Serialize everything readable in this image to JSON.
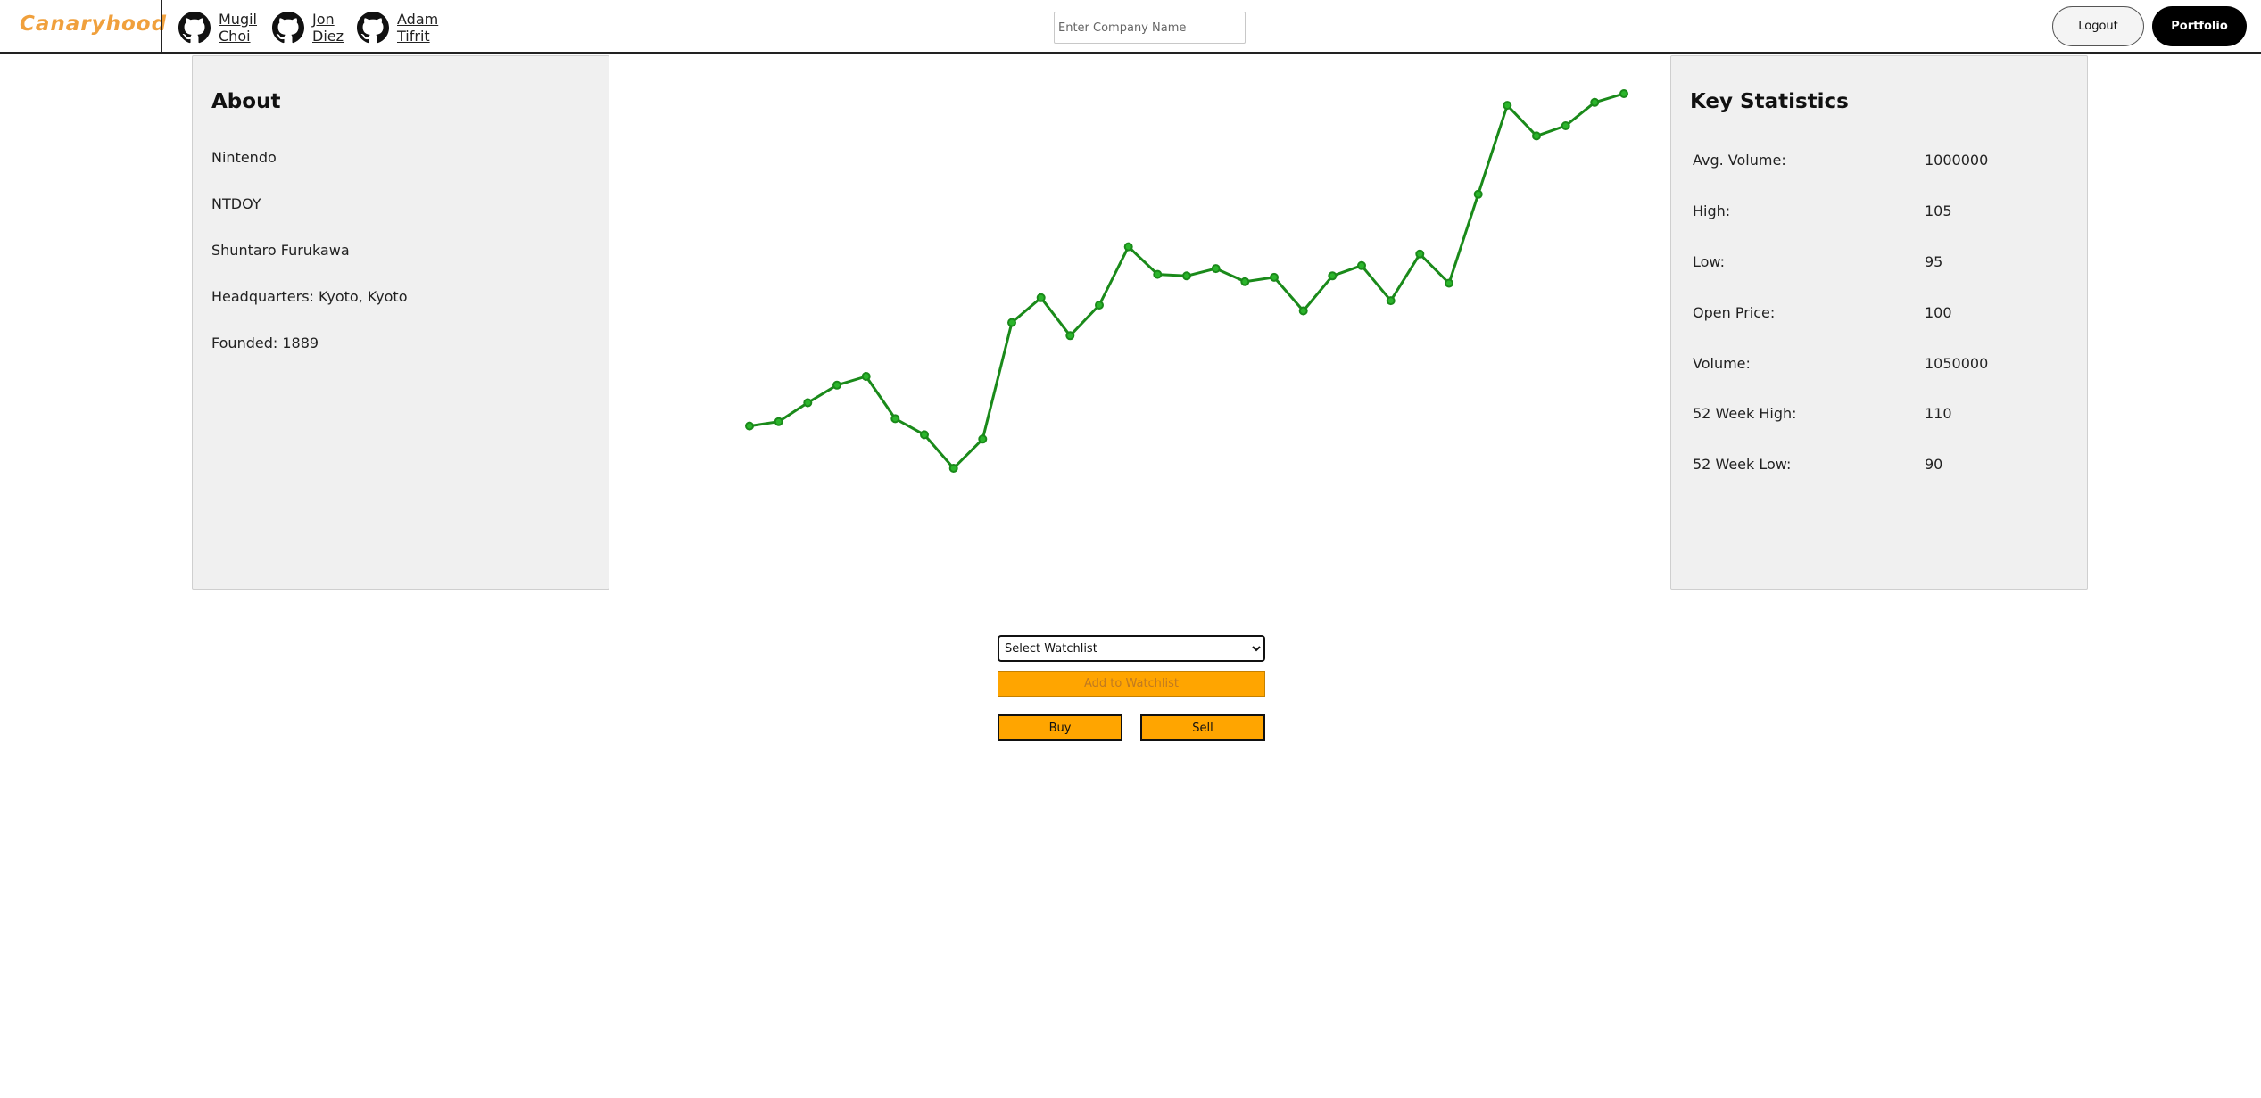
{
  "header": {
    "logo": "Canaryhood",
    "authors": [
      {
        "name": "Mugil Choi",
        "icon": "github-icon"
      },
      {
        "name": "Jon Diez",
        "icon": "github-icon"
      },
      {
        "name": "Adam Tifrit",
        "icon": "github-icon"
      }
    ],
    "search_placeholder": "Enter Company Name",
    "search_value": "",
    "logout_label": "Logout",
    "portfolio_label": "Portfolio"
  },
  "about": {
    "title": "About",
    "company": "Nintendo",
    "ticker": "NTDOY",
    "ceo": "Shuntaro Furukawa",
    "headquarters": "Headquarters: Kyoto, Kyoto",
    "founded": "Founded: 1889"
  },
  "stats": {
    "title": "Key Statistics",
    "rows": [
      {
        "label": "Avg. Volume:",
        "value": "1000000"
      },
      {
        "label": "High:",
        "value": "105"
      },
      {
        "label": "Low:",
        "value": "95"
      },
      {
        "label": "Open Price:",
        "value": "100"
      },
      {
        "label": "Volume:",
        "value": "1050000"
      },
      {
        "label": "52 Week High:",
        "value": "110"
      },
      {
        "label": "52 Week Low:",
        "value": "90"
      }
    ]
  },
  "chart_data": {
    "type": "line",
    "line_color": "#1a8a1a",
    "point_fill": "#2bb52b",
    "axes_shown": false,
    "grid": false,
    "legend": "none",
    "x": [
      1,
      2,
      3,
      4,
      5,
      6,
      7,
      8,
      9,
      10,
      11,
      12,
      13,
      14,
      15,
      16,
      17,
      18,
      19,
      20,
      21,
      22,
      23,
      24,
      25,
      26,
      27,
      28,
      29,
      30,
      31
    ],
    "values": [
      92.4,
      92.7,
      94.0,
      95.2,
      95.8,
      92.9,
      91.8,
      89.5,
      91.5,
      99.5,
      101.2,
      98.6,
      100.7,
      104.7,
      102.8,
      102.7,
      103.2,
      102.3,
      102.6,
      100.3,
      102.7,
      103.4,
      101.0,
      104.2,
      102.2,
      108.3,
      114.4,
      112.3,
      113.0,
      114.6,
      115.2
    ]
  },
  "actions": {
    "watchlist_select": "Select Watchlist",
    "watchlist_options": [
      "Select Watchlist"
    ],
    "add_label": "Add to Watchlist",
    "buy_label": "Buy",
    "sell_label": "Sell"
  }
}
